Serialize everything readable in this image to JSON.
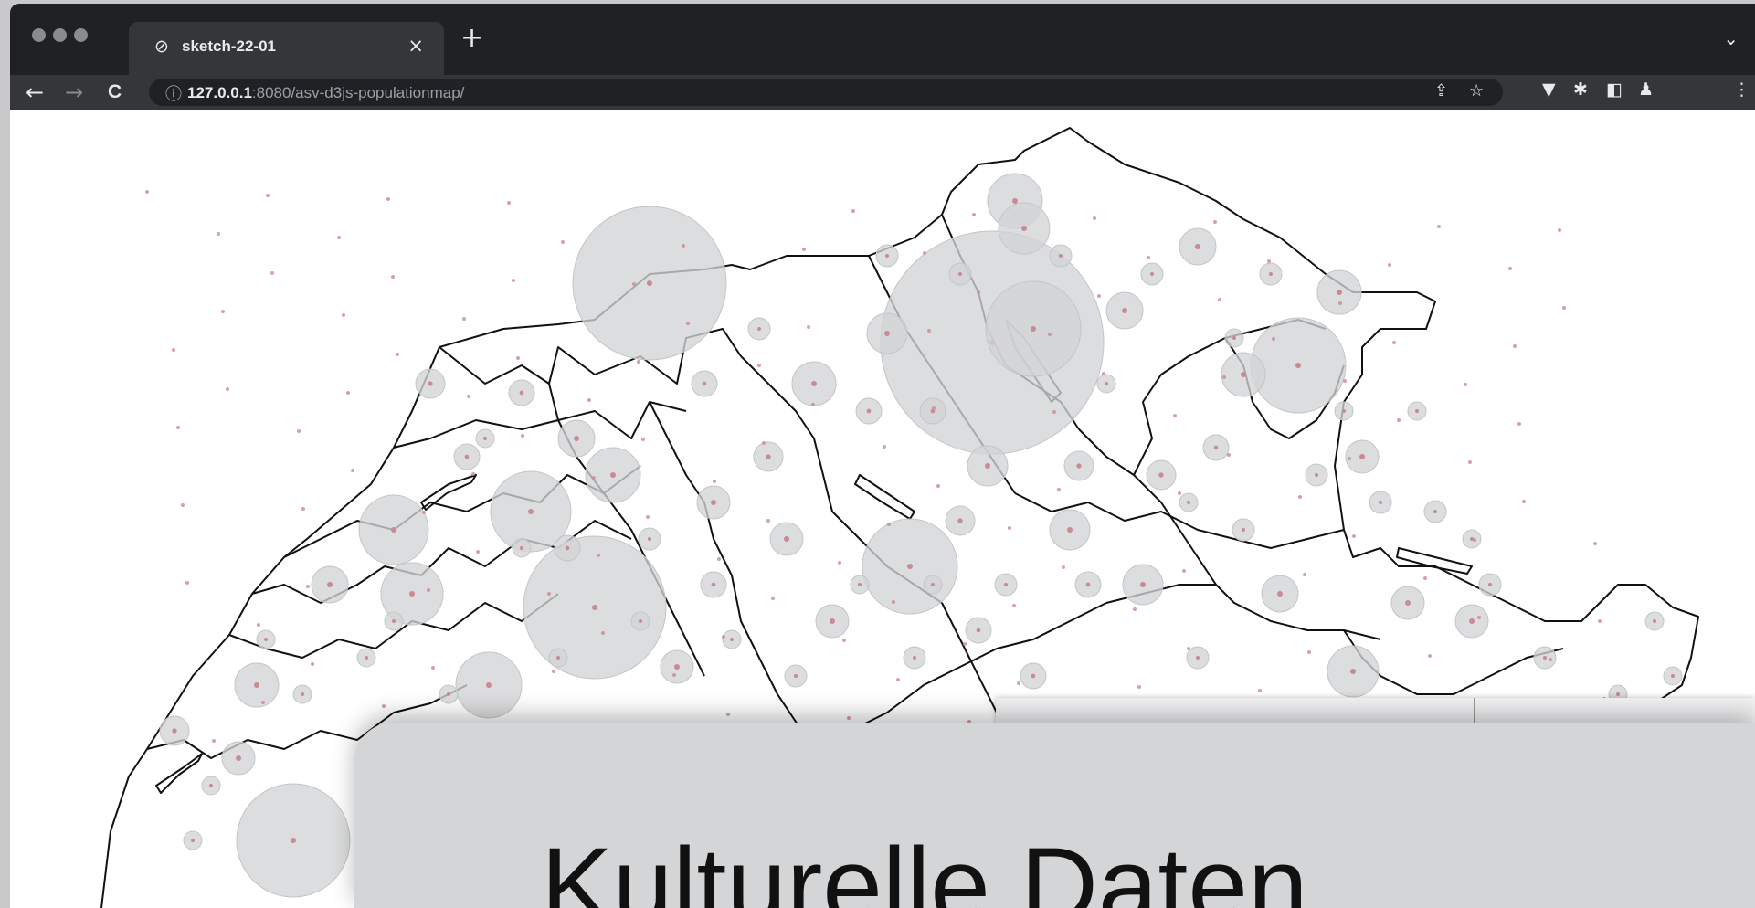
{
  "browser": {
    "tab": {
      "title": "sketch-22-01",
      "favicon": "globe-icon",
      "close": "×"
    },
    "new_tab": "+",
    "tab_menu": "⌄",
    "nav": {
      "back": "←",
      "forward": "→",
      "reload": "C"
    },
    "url": {
      "host": "127.0.0.1",
      "rest": ":8080/asv-d3js-populationmap/"
    },
    "toolbar_icons": [
      "share-icon",
      "bookmark-star-icon",
      "extension-v-icon",
      "puzzle-icon",
      "sidebar-icon",
      "profile-icon",
      "menu-icon"
    ]
  },
  "page": {
    "title": "Kulturelle Daten",
    "map": {
      "stroke_color": "#111111",
      "bubble_color": "#d2d3d5",
      "dot_color": "#c98a93"
    }
  }
}
